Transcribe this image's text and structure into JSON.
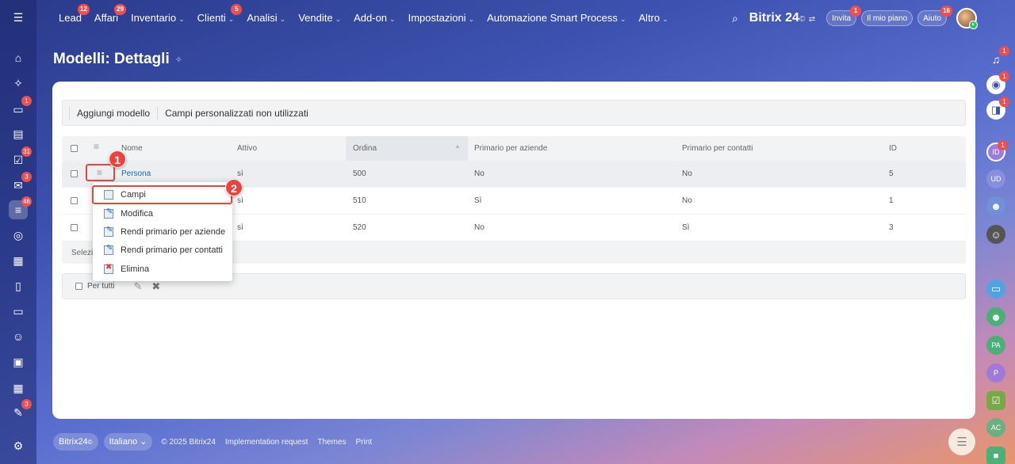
{
  "top_nav": [
    {
      "label": "Lead",
      "badge": "12",
      "chevron": ""
    },
    {
      "label": "Affari",
      "badge": "29",
      "chevron": ""
    },
    {
      "label": "Inventario",
      "badge": "",
      "chevron": "⌄"
    },
    {
      "label": "Clienti",
      "badge": "5",
      "chevron": "⌄"
    },
    {
      "label": "Analisi",
      "badge": "",
      "chevron": "⌄"
    },
    {
      "label": "Vendite",
      "badge": "",
      "chevron": "⌄"
    },
    {
      "label": "Add-on",
      "badge": "",
      "chevron": "⌄"
    },
    {
      "label": "Impostazioni",
      "badge": "",
      "chevron": "⌄"
    },
    {
      "label": "Automazione Smart Process",
      "badge": "",
      "chevron": "⌄"
    },
    {
      "label": "Altro",
      "badge": "",
      "chevron": "⌄"
    }
  ],
  "brand": {
    "name": "Bitrix 24",
    "mark": "©",
    "swap": "⇄"
  },
  "top_right": {
    "invite": "Invita",
    "invite_badge": "1",
    "my_plan": "Il mio piano",
    "help": "Aiuto",
    "help_badge": "16"
  },
  "left_sidebar_badges": {
    "chat": "1",
    "tasks": "31",
    "mail": "3",
    "crm": "46",
    "last": "3"
  },
  "right_sidebar": {
    "bell_badge": "1",
    "copilot_badge": "1",
    "chat_badge": "1",
    "id_badge": "1",
    "avatars": [
      "ID",
      "UD",
      "PA",
      "P",
      "AC"
    ]
  },
  "page": {
    "title": "Modelli: Dettagli",
    "pin_icon": "pin-icon"
  },
  "toolbar": {
    "add_model": "Aggiungi modello",
    "unused_fields": "Campi personalizzati non utilizzati"
  },
  "grid": {
    "columns": {
      "name": "Nome",
      "active": "Attivo",
      "order": "Ordina",
      "primary_companies": "Primario per aziende",
      "primary_contacts": "Primario per contatti",
      "id": "ID",
      "sort_arrow": "^"
    },
    "rows": [
      {
        "name": "Persona",
        "active": "sì",
        "order": "500",
        "primary_companies": "No",
        "primary_contacts": "No",
        "id": "5"
      },
      {
        "name": "",
        "active": "sì",
        "order": "510",
        "primary_companies": "Sì",
        "primary_contacts": "No",
        "id": "1"
      },
      {
        "name": "",
        "active": "sì",
        "order": "520",
        "primary_companies": "No",
        "primary_contacts": "Sì",
        "id": "3"
      }
    ],
    "footer_label": "Selezio"
  },
  "action_bar": {
    "for_all": "Per tutti"
  },
  "context_menu": [
    "Campi",
    "Modifica",
    "Rendi primario per aziende",
    "Rendi primario per contatti",
    "Elimina"
  ],
  "steps": [
    "1",
    "2"
  ],
  "footer": {
    "brand": "Bitrix24",
    "brand_mark": "©",
    "language": "Italiano",
    "copyright": "© 2025 Bitrix24",
    "impl": "Implementation request",
    "themes": "Themes",
    "print": "Print"
  },
  "colors": {
    "accent": "#e8453c",
    "link": "#2067b0",
    "badge": "#f14e4e"
  }
}
